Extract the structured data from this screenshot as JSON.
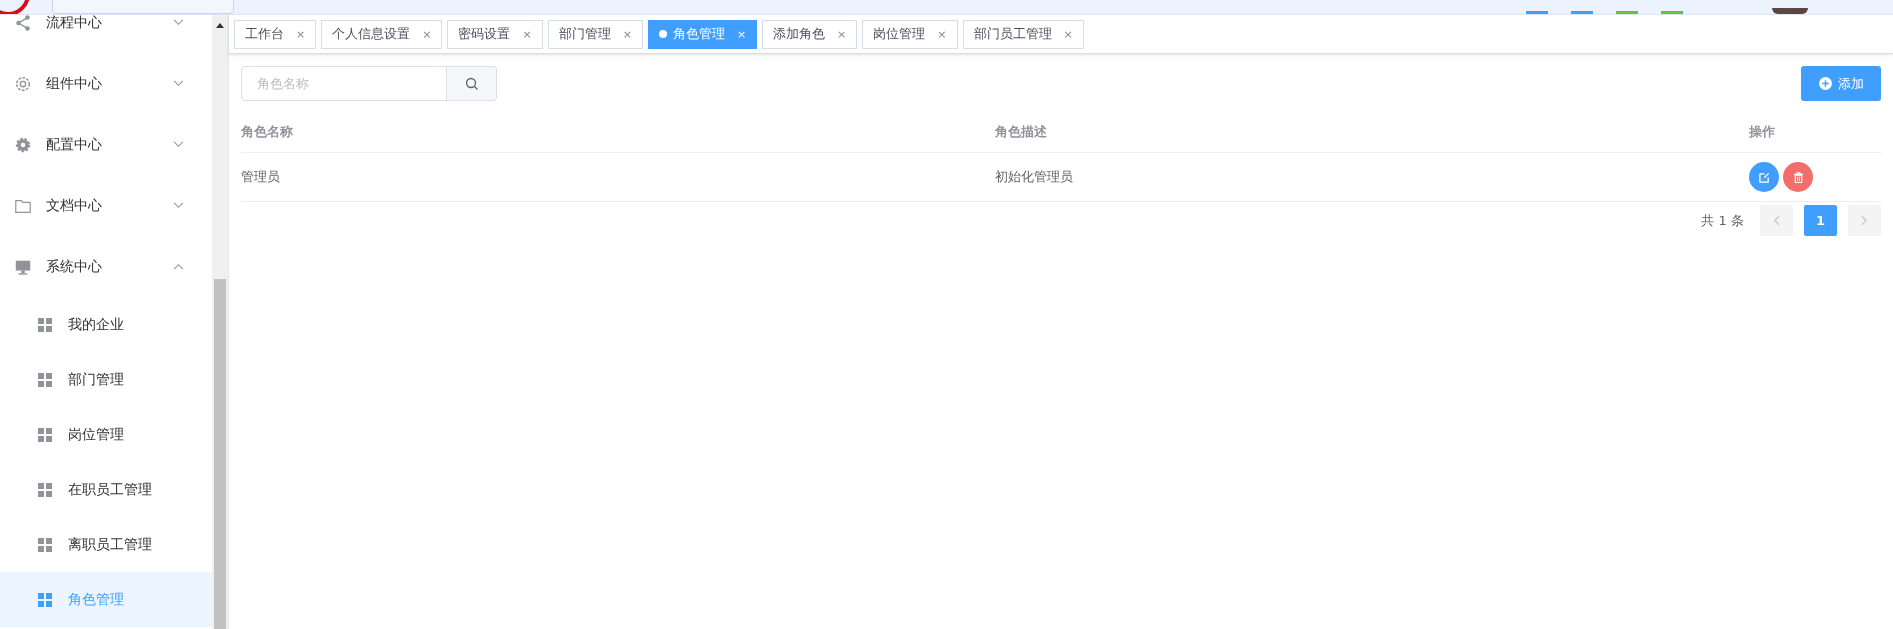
{
  "sidebar": {
    "items": [
      {
        "label": "流程中心",
        "expanded": false
      },
      {
        "label": "组件中心",
        "expanded": false
      },
      {
        "label": "配置中心",
        "expanded": false
      },
      {
        "label": "文档中心",
        "expanded": false
      },
      {
        "label": "系统中心",
        "expanded": true,
        "children": [
          {
            "label": "我的企业",
            "selected": false
          },
          {
            "label": "部门管理",
            "selected": false
          },
          {
            "label": "岗位管理",
            "selected": false
          },
          {
            "label": "在职员工管理",
            "selected": false
          },
          {
            "label": "离职员工管理",
            "selected": false
          },
          {
            "label": "角色管理",
            "selected": true
          }
        ]
      }
    ]
  },
  "tabs": [
    {
      "label": "工作台",
      "selected": false
    },
    {
      "label": "个人信息设置",
      "selected": false
    },
    {
      "label": "密码设置",
      "selected": false
    },
    {
      "label": "部门管理",
      "selected": false
    },
    {
      "label": "角色管理",
      "selected": true
    },
    {
      "label": "添加角色",
      "selected": false
    },
    {
      "label": "岗位管理",
      "selected": false
    },
    {
      "label": "部门员工管理",
      "selected": false
    }
  ],
  "close_glyph": "×",
  "search": {
    "placeholder": "角色名称"
  },
  "add_button": "添加",
  "table": {
    "columns": [
      "角色名称",
      "角色描述",
      "操作"
    ],
    "rows": [
      {
        "name": "管理员",
        "description": "初始化管理员"
      }
    ]
  },
  "pagination": {
    "total": "共 1 条",
    "pages": [
      {
        "label": "1",
        "selected": true
      }
    ]
  }
}
